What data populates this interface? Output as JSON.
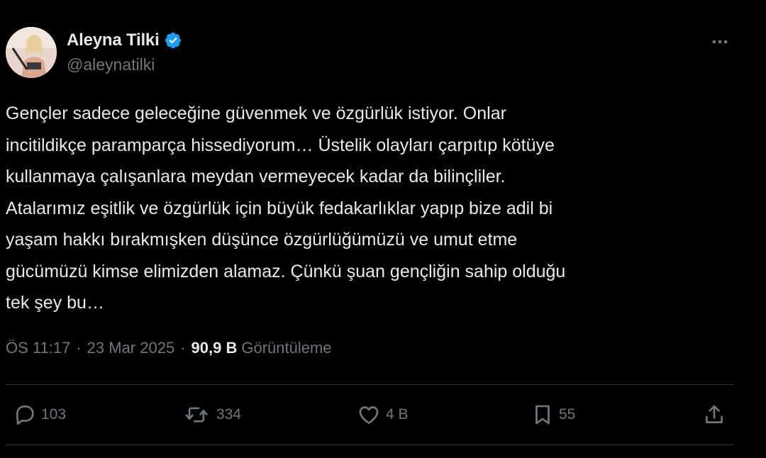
{
  "author": {
    "display_name": "Aleyna Tilki",
    "handle": "@aleynatilki",
    "verified": true,
    "verified_color": "#1d9bf0"
  },
  "tweet": {
    "lines": [
      "Gençler sadece geleceğine güvenmek ve özgürlük istiyor. Onlar",
      "incitildikçe paramparça hissediyorum… Üstelik olayları çarpıtıp kötüye",
      "kullanmaya çalışanlara meydan vermeyecek kadar da bilinçliler.",
      "Atalarımız eşitlik ve özgürlük için büyük fedakarlıklar yapıp bize adil bi",
      "yaşam hakkı bırakmışken düşünce özgürlüğümüzü ve umut etme",
      "gücümüzü kimse  elimizden alamaz. Çünkü şuan gençliğin sahip olduğu",
      "tek şey bu…"
    ]
  },
  "meta": {
    "time": "ÖS 11:17",
    "separator": "·",
    "date": "23 Mar 2025",
    "views_count": "90,9 B",
    "views_label": "Görüntüleme"
  },
  "actions": {
    "reply": {
      "icon": "reply-icon",
      "count": "103"
    },
    "retweet": {
      "icon": "retweet-icon",
      "count": "334"
    },
    "like": {
      "icon": "heart-icon",
      "count": "4 B"
    },
    "bookmark": {
      "icon": "bookmark-icon",
      "count": "55"
    },
    "share": {
      "icon": "share-icon"
    }
  },
  "colors": {
    "background": "#000000",
    "text_primary": "#e7e9ea",
    "text_secondary": "#71767b",
    "divider": "#2f3336"
  }
}
